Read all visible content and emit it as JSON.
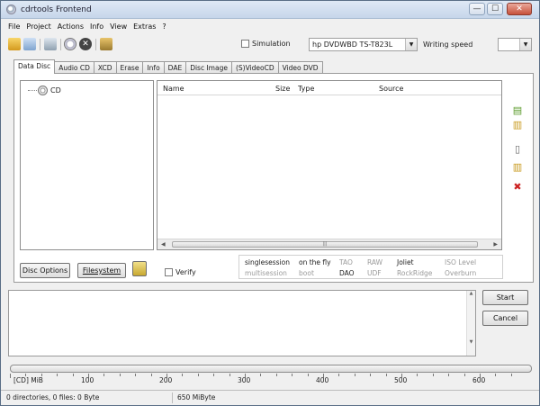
{
  "window": {
    "title": "cdrtools Frontend"
  },
  "titlebar_buttons": {
    "minimize": "—",
    "maximize": "☐",
    "close": "✕"
  },
  "menu": [
    {
      "label": "File"
    },
    {
      "label": "Project"
    },
    {
      "label": "Actions"
    },
    {
      "label": "Info"
    },
    {
      "label": "View"
    },
    {
      "label": "Extras"
    },
    {
      "label": "?"
    }
  ],
  "toolbar": {
    "simulation_label": "Simulation",
    "drive_value": "hp DVDWBD TS-T823L",
    "writing_speed_label": "Writing speed",
    "writing_speed_value": ""
  },
  "tabs": [
    {
      "label": "Data Disc",
      "active": true
    },
    {
      "label": "Audio CD"
    },
    {
      "label": "XCD"
    },
    {
      "label": "Erase"
    },
    {
      "label": "Info"
    },
    {
      "label": "DAE"
    },
    {
      "label": "Disc Image"
    },
    {
      "label": "(S)VideoCD"
    },
    {
      "label": "Video DVD"
    }
  ],
  "tree": {
    "root_label": "CD"
  },
  "file_columns": [
    "Name",
    "Size",
    "Type",
    "Source"
  ],
  "buttons": {
    "disc_options": "Disc Options",
    "filesystem": "Filesystem",
    "start": "Start",
    "cancel": "Cancel"
  },
  "verify_label": "Verify",
  "modes": {
    "row1": [
      "singlesession",
      "on the fly",
      "TAO",
      "RAW",
      "Joliet",
      "ISO Level"
    ],
    "row2": [
      "multisession",
      "boot",
      "DAO",
      "UDF",
      "RockRidge",
      "Overburn"
    ],
    "enabled_row1": [
      true,
      true,
      false,
      false,
      true,
      false
    ],
    "enabled_row2": [
      false,
      false,
      true,
      false,
      false,
      false
    ]
  },
  "ruler": {
    "unit_label": "[CD] MiB",
    "labels": [
      "100",
      "200",
      "300",
      "400",
      "500",
      "600"
    ]
  },
  "status": {
    "left": "0 directories, 0 files: 0 Byte",
    "right": "650 MiByte"
  },
  "colors": {
    "accent_green": "#5a9a2a",
    "accent_red": "#cc2222",
    "icon_yellow": "#e0b020"
  }
}
